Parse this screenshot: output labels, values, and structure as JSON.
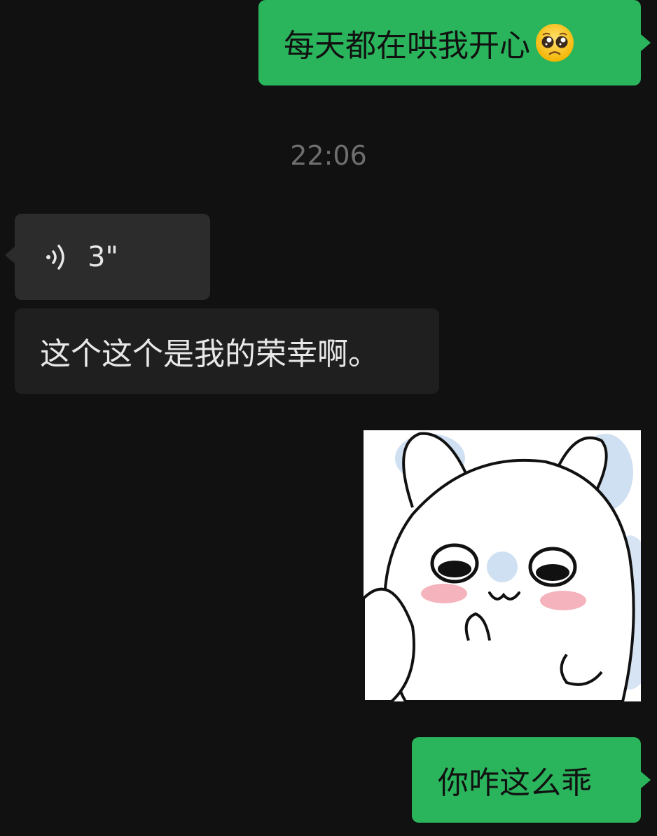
{
  "chat": {
    "messages": [
      {
        "type": "text",
        "direction": "outgoing",
        "text": "每天都在哄我开心",
        "emoji": "pleading-face-emoji"
      },
      {
        "type": "timestamp",
        "text": "22:06"
      },
      {
        "type": "voice",
        "direction": "incoming",
        "duration": "3\""
      },
      {
        "type": "text",
        "direction": "incoming",
        "text": "这个这个是我的荣幸啊。"
      },
      {
        "type": "sticker",
        "direction": "outgoing",
        "description": "white-bunny-sticker"
      },
      {
        "type": "text",
        "direction": "outgoing",
        "text": "你咋这么乖"
      }
    ]
  },
  "colors": {
    "background": "#111111",
    "outgoing_bubble": "#2ab55c",
    "incoming_bubble": "#2c2c2c",
    "timestamp_text": "#6f6f6f"
  },
  "icons": {
    "voice": "voice-wave-icon",
    "emoji": "pleading-face-emoji"
  }
}
